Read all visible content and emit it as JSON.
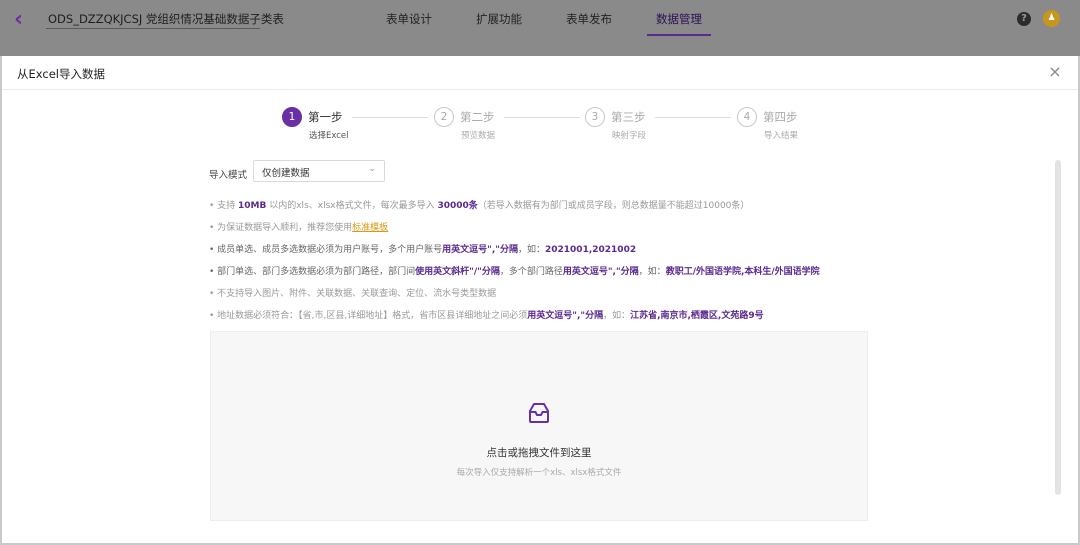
{
  "header": {
    "title": "ODS_DZZQKJCSJ 党组织情况基础数据子类表",
    "tabs": [
      {
        "label": "表单设计",
        "active": false
      },
      {
        "label": "扩展功能",
        "active": false
      },
      {
        "label": "表单发布",
        "active": false
      },
      {
        "label": "数据管理",
        "active": true
      }
    ],
    "help_icon_glyph": "?",
    "avatar_glyph": "♟"
  },
  "modal": {
    "title": "从Excel导入数据",
    "close_glyph": "×"
  },
  "steps": [
    {
      "num": "1",
      "title": "第一步",
      "subtitle": "选择Excel",
      "active": true
    },
    {
      "num": "2",
      "title": "第二步",
      "subtitle": "预览数据",
      "active": false
    },
    {
      "num": "3",
      "title": "第三步",
      "subtitle": "映射字段",
      "active": false
    },
    {
      "num": "4",
      "title": "第四步",
      "subtitle": "导入结果",
      "active": false
    }
  ],
  "import_mode": {
    "label": "导入模式",
    "value": "仅创建数据"
  },
  "tips": {
    "t1": {
      "a": "• 支持 ",
      "b1": "10MB",
      "c": " 以内的xls、xlsx格式文件，每次最多导入 ",
      "b2": "30000条",
      "d": "（若导入数据有为部门或成员字段，则总数据量不能超过10000条）"
    },
    "t2": {
      "a": "• 为保证数据导入顺利，推荐您使用",
      "link": "标准模板"
    },
    "t3": {
      "a": "• 成员单选、成员多选数据必须为用户账号，多个用户账号",
      "b1": "用英文逗号\",\"分隔",
      "c": "，如：",
      "b2": "2021001,2021002"
    },
    "t4": {
      "a": "• 部门单选、部门多选数据必须为部门路径，部门间",
      "b1": "使用英文斜杆\"/\"分隔",
      "c": "，多个部门路径",
      "b2": "用英文逗号\",\"分隔",
      "d": "，如：",
      "b3": "教职工/外国语学院,本科生/外国语学院"
    },
    "t5": {
      "a": "• 不支持导入图片、附件、关联数据、关联查询、定位、流水号类型数据"
    },
    "t6": {
      "a": "• 地址数据必须符合：【省,市,区县,详细地址】格式，省市区县详细地址之间必须",
      "b1": "用英文逗号\",\"分隔",
      "c": "，如：",
      "b2": "江苏省,南京市,栖霞区,文苑路9号"
    }
  },
  "dropzone": {
    "title": "点击或拖拽文件到这里",
    "subtitle": "每次导入仅支持解析一个xls、xlsx格式文件"
  },
  "colors": {
    "accent": "#6b2fa5",
    "link": "#d79a12"
  }
}
